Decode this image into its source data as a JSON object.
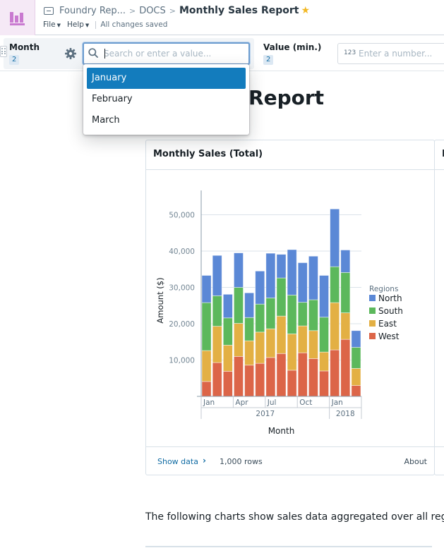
{
  "header": {
    "breadcrumbs": [
      "Foundry Rep...",
      "DOCS"
    ],
    "title": "Monthly Sales Report",
    "menus": [
      "File",
      "Help"
    ],
    "save_status": "All changes saved",
    "app_icon": "bar-chart-icon",
    "starred": true
  },
  "filters": {
    "month": {
      "label": "Month",
      "count": "2",
      "search_placeholder": "Search or enter a value...",
      "search_value": "",
      "options": [
        "January",
        "February",
        "March"
      ],
      "highlighted": "January"
    },
    "value_min": {
      "label": "Value (min.)",
      "count": "2",
      "type_badge": "123",
      "placeholder": "Enter a number..."
    }
  },
  "page": {
    "title": "Monthly Sales Report",
    "paragraph": "The following charts show sales data aggregated over all regions"
  },
  "card": {
    "title": "Monthly Sales (Total)",
    "second_card_title": "M",
    "footer": {
      "show_data": "Show data",
      "rows": "1,000 rows",
      "about": "About"
    }
  },
  "colors": {
    "North": "#5b88d6",
    "South": "#5cb85c",
    "East": "#e3b044",
    "West": "#dc6548",
    "accent": "#137cbd"
  },
  "chart_data": {
    "type": "bar",
    "stacked": true,
    "title": "Monthly Sales (Total)",
    "xlabel": "Month",
    "ylabel": "Amount ($)",
    "ylim": [
      0,
      55000
    ],
    "yticks": [
      10000,
      20000,
      30000,
      40000,
      50000
    ],
    "ytick_labels": [
      "10,000",
      "20,000",
      "30,000",
      "40,000",
      "50,000"
    ],
    "grid": true,
    "legend_title": "Regions",
    "legend_position": "right",
    "categories": [
      "2017-01",
      "2017-02",
      "2017-03",
      "2017-04",
      "2017-05",
      "2017-06",
      "2017-07",
      "2017-08",
      "2017-09",
      "2017-10",
      "2017-11",
      "2017-12",
      "2018-01",
      "2018-02",
      "2018-03"
    ],
    "x_month_labels": [
      {
        "label": "Jan",
        "index": 0
      },
      {
        "label": "Apr",
        "index": 3
      },
      {
        "label": "Jul",
        "index": 6
      },
      {
        "label": "Oct",
        "index": 9
      },
      {
        "label": "Jan",
        "index": 12
      }
    ],
    "x_year_labels": [
      {
        "label": "2017",
        "start": 0,
        "end": 11
      },
      {
        "label": "2018",
        "start": 12,
        "end": 14
      }
    ],
    "series": [
      {
        "name": "West",
        "values": [
          4100,
          9300,
          6900,
          11000,
          8600,
          9100,
          10700,
          11800,
          7200,
          12000,
          10400,
          7000,
          12800,
          15700,
          3000
        ]
      },
      {
        "name": "East",
        "values": [
          8500,
          10000,
          7200,
          9100,
          6700,
          8600,
          7900,
          10300,
          10000,
          7400,
          7700,
          5200,
          13000,
          7300,
          4700
        ]
      },
      {
        "name": "South",
        "values": [
          13200,
          8400,
          7500,
          9900,
          6400,
          7700,
          8500,
          10500,
          10700,
          6500,
          8500,
          9600,
          9900,
          11100,
          5800
        ]
      },
      {
        "name": "North",
        "values": [
          7500,
          11100,
          6500,
          9500,
          6800,
          9100,
          12300,
          6500,
          12500,
          10900,
          12000,
          11500,
          15900,
          6200,
          4600
        ]
      }
    ],
    "legend_order": [
      "North",
      "South",
      "East",
      "West"
    ]
  }
}
